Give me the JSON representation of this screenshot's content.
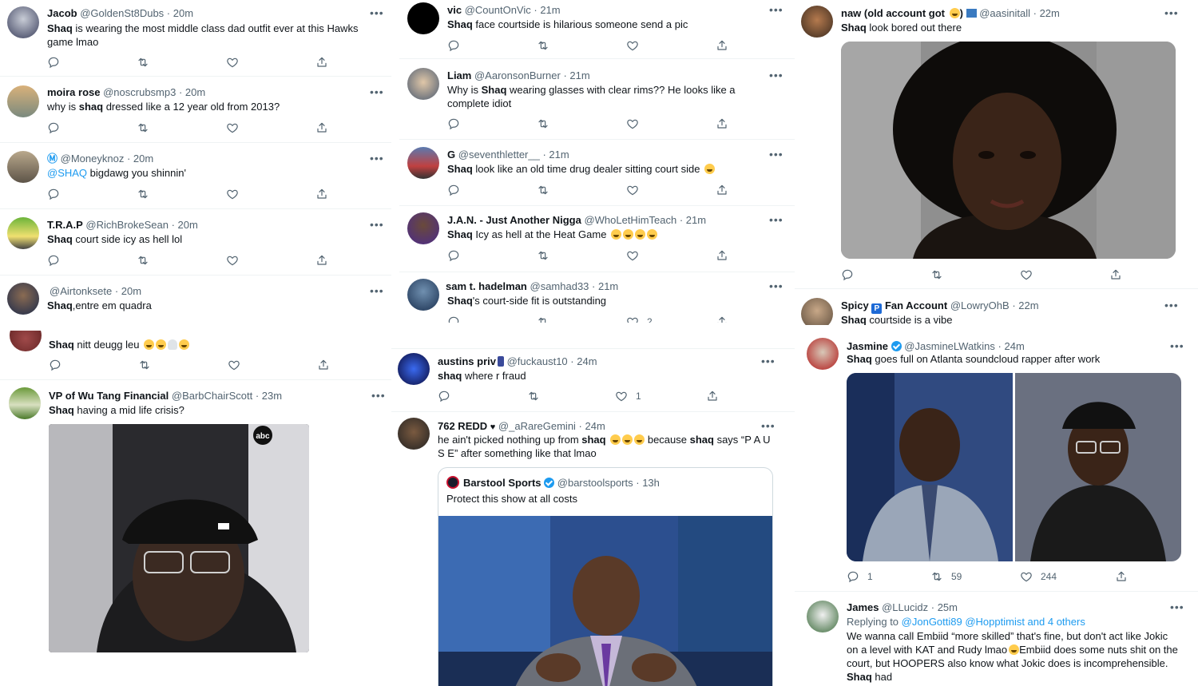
{
  "more_label": "•••",
  "column1": [
    {
      "name": "Jacob",
      "handle": "@GoldenSt8Dubs",
      "time": "20m",
      "t1": "Shaq",
      "t2": " is wearing the most middle class dad outfit ever at this Hawks game lmao"
    },
    {
      "name": "moira rose",
      "handle": "@noscrubsmp3",
      "time": "20m",
      "t1": "why is ",
      "t2": "shaq",
      "t3": " dressed like a 12 year old from 2013?"
    },
    {
      "name": "Ⓜ",
      "handle": "@Moneyknoz",
      "time": "20m",
      "t1": "@SHAQ",
      "t2": " bigdawg you shinnin'"
    },
    {
      "name": "T.R.A.P",
      "handle": "@RichBrokeSean",
      "time": "20m",
      "t1": "Shaq",
      "t2": " court side icy as hell lol"
    },
    {
      "name": "",
      "handle": "@Airtonksete",
      "time": "20m",
      "t1": "Shaq",
      "t2": ",entre em quadra"
    },
    {
      "t1": "Shaq",
      "t2": " nitt deugg leu"
    },
    {
      "name": "VP of Wu Tang Financial",
      "handle": "@BarbChairScott",
      "time": "23m",
      "t1": "Shaq",
      "t2": " having a mid life crisis?"
    }
  ],
  "column2": [
    {
      "name": "vic",
      "handle": "@CountOnVic",
      "time": "21m",
      "t1": "Shaq",
      "t2": " face courtside is hilarious someone send a pic"
    },
    {
      "name": "Liam",
      "handle": "@AaronsonBurner",
      "time": "21m",
      "t1": "Why is ",
      "t2": "Shaq",
      "t3": " wearing glasses with clear rims?? He looks like a complete idiot"
    },
    {
      "name": "G",
      "handle": "@seventhletter__",
      "time": "21m",
      "t1": "Shaq",
      "t2": " look like an old time drug dealer sitting court side"
    },
    {
      "name": "J.A.N. - Just Another Nigga",
      "handle": "@WhoLetHimTeach",
      "time": "21m",
      "t1": "Shaq",
      "t2": " Icy as hell at the Heat Game"
    },
    {
      "name": "sam t. hadelman",
      "handle": "@samhad33",
      "time": "21m",
      "t1": "Shaq",
      "t2": "'s court-side fit is outstanding",
      "like_count": "2"
    },
    {
      "name": "austins priv",
      "handle": "@fuckaust10",
      "time": "24m",
      "t1": "shaq",
      "t2": " where r fraud",
      "like_count": "1"
    },
    {
      "name": "762 REDD",
      "handle": "@_aRareGemini",
      "time": "24m",
      "t1": "he ain't picked nothing up from ",
      "t2": "shaq",
      "t3": " because ",
      "t4": "shaq",
      "t5": " says “P A U S E” after something like that lmao",
      "quote": {
        "name": "Barstool Sports",
        "handle": "@barstoolsports",
        "time": "13h",
        "text": "Protect this show at all costs"
      }
    }
  ],
  "column3": [
    {
      "name": "naw (old account got",
      "name_suffix": ")",
      "handle": "@aasinitall",
      "time": "22m",
      "t1": "Shaq",
      "t2": " look bored out there"
    },
    {
      "name": "Spicy",
      "name2": "Fan Account",
      "handle": "@LowryOhB",
      "time": "22m",
      "t1": "Shaq",
      "t2": " courtside is a vibe"
    },
    {
      "name": "Jasmine",
      "handle": "@JasmineLWatkins",
      "time": "24m",
      "t1": "Shaq",
      "t2": " goes full on Atlanta soundcloud rapper after work",
      "reply_count": "1",
      "rt_count": "59",
      "like_count": "244"
    },
    {
      "name": "James",
      "handle": "@LLucidz",
      "time": "25m",
      "reply_label": "Replying to ",
      "reply_to": "@JonGotti89 @Hopptimist and 4 others",
      "t1": "We wanna call Embiid “more skilled” that's fine, but don't act like Jokic on a level with KAT and Rudy lmao",
      "t2": "Embiid does some nuts shit on the court, but HOOPERS also know what Jokic does is incomprehensible. ",
      "t3": "Shaq",
      "t4": " had"
    }
  ],
  "colors": {
    "text": "#0f1419",
    "secondary": "#536471",
    "accent": "#1d9bf0",
    "divider": "#eff3f4"
  }
}
